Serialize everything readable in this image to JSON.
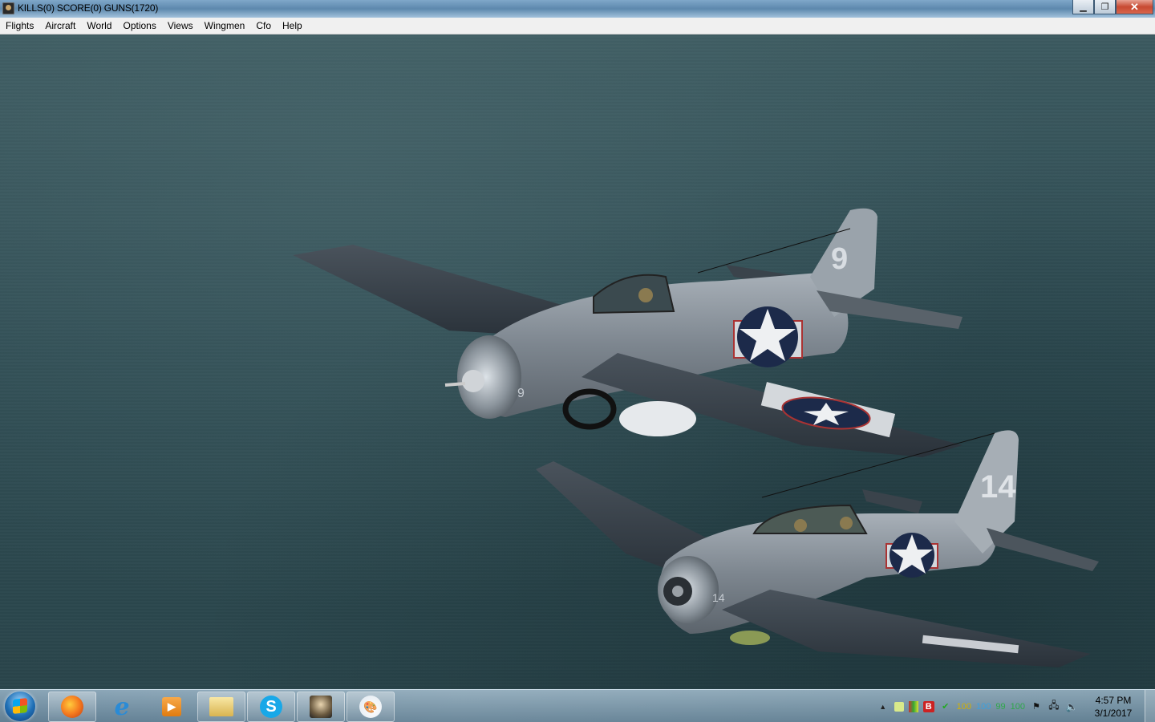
{
  "window": {
    "title": "KILLS(0) SCORE(0) GUNS(1720)",
    "minimize": "▁",
    "maximize": "❐",
    "close": "✕"
  },
  "menu": [
    "Flights",
    "Aircraft",
    "World",
    "Options",
    "Views",
    "Wingmen",
    "Cfo",
    "Help"
  ],
  "scene": {
    "aircraft_1_number": "9",
    "aircraft_2_number": "14",
    "aircraft_2_cowl_number": "14",
    "aircraft_1_cowl_number": "9"
  },
  "taskbar": {
    "apps": [
      "firefox-icon",
      "internet-explorer-icon",
      "media-player-icon",
      "file-explorer-icon",
      "skype-icon",
      "game-icon",
      "paint-icon"
    ],
    "tray": {
      "nums": [
        "100",
        "100",
        "99",
        "100"
      ],
      "num_colors": [
        "#d4b000",
        "#3aa0e0",
        "#2fa84a",
        "#2fa84a"
      ],
      "time": "4:57 PM",
      "date": "3/1/2017"
    }
  },
  "colors": {
    "sea": "#2f4c53",
    "aircraft_gray": "#7f8891",
    "aircraft_dark": "#2e3740"
  }
}
